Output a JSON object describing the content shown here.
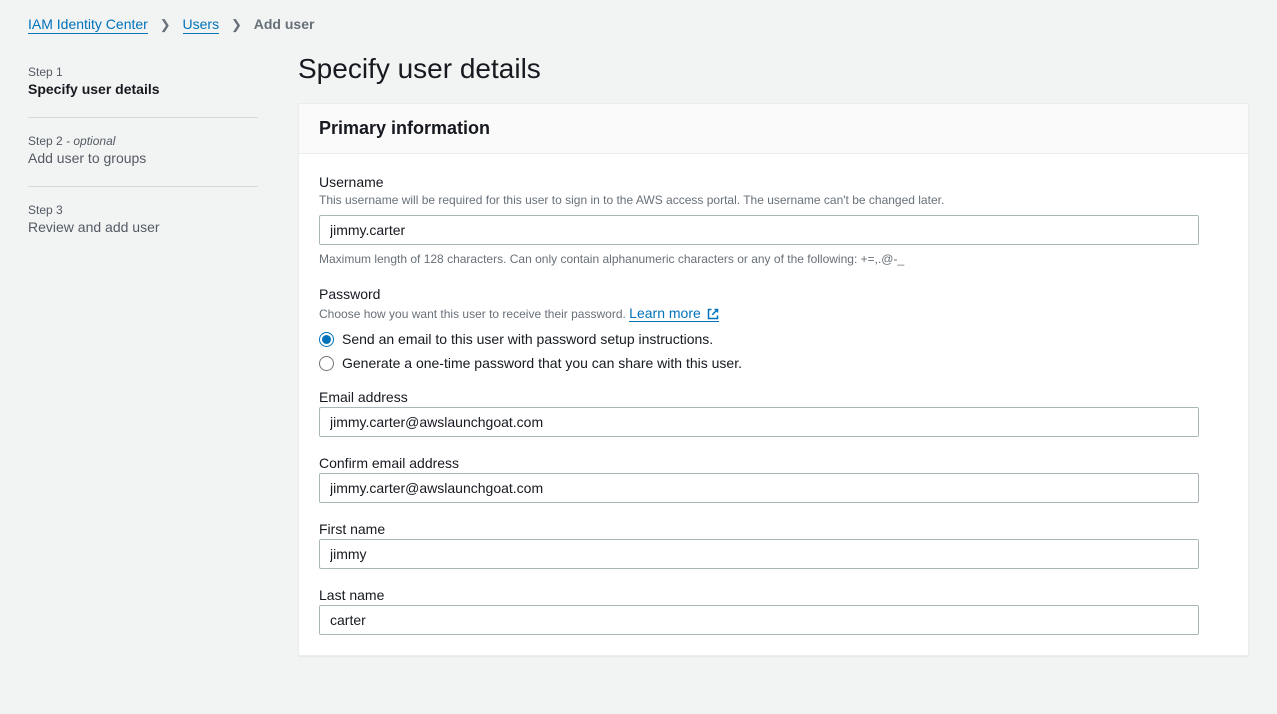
{
  "breadcrumb": {
    "root": "IAM Identity Center",
    "users": "Users",
    "current": "Add user"
  },
  "wizard": {
    "step1": {
      "num": "Step 1",
      "title": "Specify user details"
    },
    "step2": {
      "num": "Step 2",
      "opt": " - optional",
      "title": "Add user to groups"
    },
    "step3": {
      "num": "Step 3",
      "title": "Review and add user"
    }
  },
  "pageTitle": "Specify user details",
  "panel": {
    "heading": "Primary information",
    "username": {
      "label": "Username",
      "desc": "This username will be required for this user to sign in to the AWS access portal. The username can't be changed later.",
      "value": "jimmy.carter",
      "hint": "Maximum length of 128 characters. Can only contain alphanumeric characters or any of the following: +=,.@-_"
    },
    "password": {
      "label": "Password",
      "desc": "Choose how you want this user to receive their password.",
      "learnMore": "Learn more",
      "opt1": "Send an email to this user with password setup instructions.",
      "opt2": "Generate a one-time password that you can share with this user."
    },
    "email": {
      "label": "Email address",
      "value": "jimmy.carter@awslaunchgoat.com"
    },
    "confirmEmail": {
      "label": "Confirm email address",
      "value": "jimmy.carter@awslaunchgoat.com"
    },
    "firstName": {
      "label": "First name",
      "value": "jimmy"
    },
    "lastName": {
      "label": "Last name",
      "value": "carter"
    }
  }
}
